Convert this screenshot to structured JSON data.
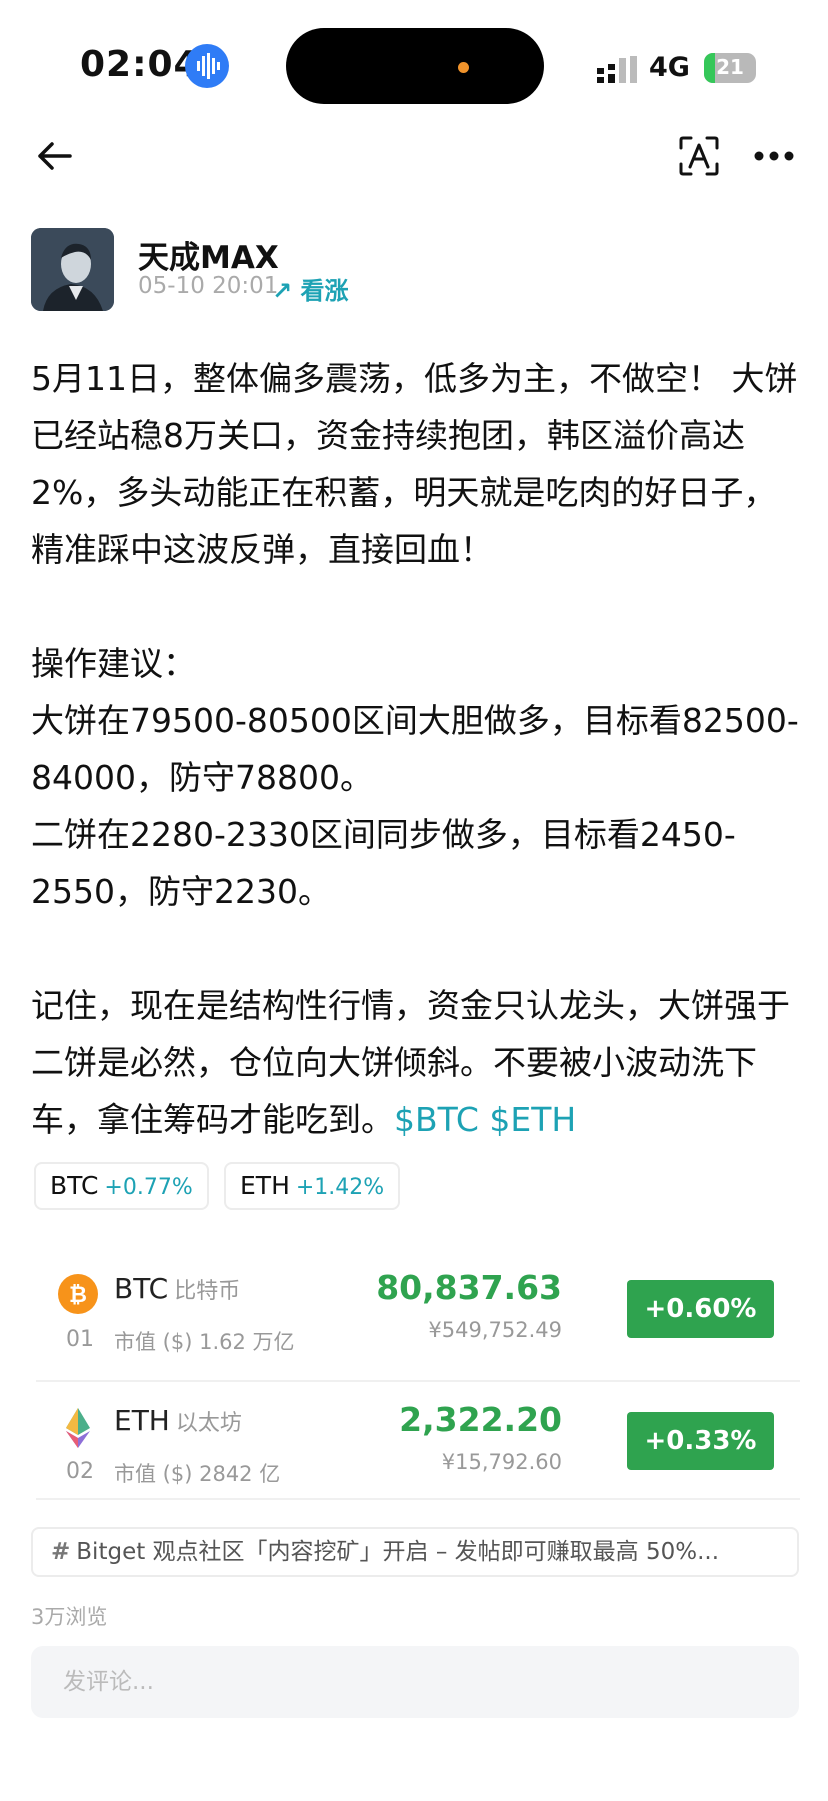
{
  "status_bar": {
    "time": "02:04",
    "network": "4G",
    "battery": "21",
    "battery_level": 0.21
  },
  "author": {
    "name": "天成MAX",
    "timestamp": "05-10 20:01",
    "sentiment": "↗ 看涨"
  },
  "post": {
    "paragraph_1": "5月11日，整体偏多震荡，低多为主，不做空！ 大饼已经站稳8万关口，资金持续抱团，韩区溢价高达2%，多头动能正在积蓄，明天就是吃肉的好日子，精准踩中这波反弹，直接回血！",
    "advice_title": "操作建议：",
    "advice_1": "大饼在79500-80500区间大胆做多，目标看82500-84000，防守78800。",
    "advice_2": "二饼在2280-2330区间同步做多，目标看2450-2550，防守2230。",
    "paragraph_3": "记住，现在是结构性行情，资金只认龙头，大饼强于二饼是必然，仓位向大饼倾斜。不要被小波动洗下车，拿住筹码才能吃到。",
    "tag_btc": "$BTC",
    "tag_eth": "$ETH"
  },
  "chips": [
    {
      "symbol": "BTC",
      "change": "+0.77%"
    },
    {
      "symbol": "ETH",
      "change": "+1.42%"
    }
  ],
  "market": [
    {
      "rank": "01",
      "symbol": "BTC",
      "name_cn": "比特币",
      "market_cap": "市值 ($) 1.62 万亿",
      "price": "80,837.63",
      "price_cny": "¥549,752.49",
      "change": "+0.60%",
      "icon": "bitcoin-icon",
      "color": "#f7931a"
    },
    {
      "rank": "02",
      "symbol": "ETH",
      "name_cn": "以太坊",
      "market_cap": "市值 ($) 2842 亿",
      "price": "2,322.20",
      "price_cny": "¥15,792.60",
      "change": "+0.33%",
      "icon": "ethereum-icon",
      "color": "#627eea"
    }
  ],
  "banner": {
    "hash": "#",
    "text": "Bitget 观点社区「内容挖矿」开启 – 发帖即可赚取最高 50%..."
  },
  "views": "3万浏览",
  "comment": {
    "placeholder": "发评论..."
  },
  "colors": {
    "accent": "#1da2b4",
    "up_green": "#2fa34f"
  }
}
